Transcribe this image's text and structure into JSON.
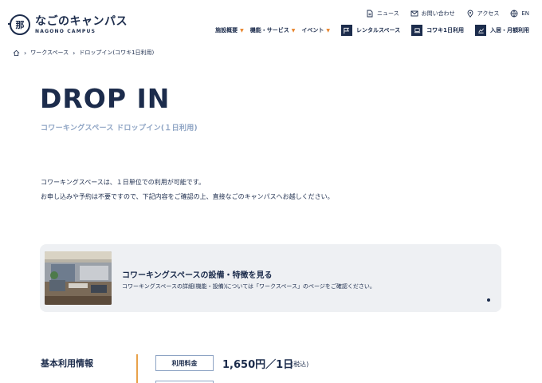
{
  "header": {
    "logo_ja": "なごのキャンパス",
    "logo_en": "NAGONO CAMPUS",
    "logo_mark": "那",
    "utility": [
      {
        "label": "ニュース",
        "icon": "document-icon"
      },
      {
        "label": "お問い合わせ",
        "icon": "mail-icon"
      },
      {
        "label": "アクセス",
        "icon": "location-pin-icon"
      },
      {
        "label": "EN",
        "icon": "globe-icon"
      }
    ],
    "nav": [
      {
        "label": "施設概要"
      },
      {
        "label": "機能・サービス"
      },
      {
        "label": "イベント"
      }
    ],
    "nav_boxes": [
      {
        "label": "レンタルスペース",
        "icon": "flag-icon"
      },
      {
        "label": "コワキ1日利用",
        "icon": "laptop-icon"
      },
      {
        "label": "入居・月額利用",
        "icon": "chart-up-icon"
      }
    ]
  },
  "breadcrumb": {
    "items": [
      "ワークスペース",
      "ドロップイン(コワキ1日利用)"
    ]
  },
  "page": {
    "title": "DROP IN",
    "subtitle": "コワーキングスペース ドロップイン(１日利用)",
    "body_line1": "コワーキングスペースは、１日単位での利用が可能です。",
    "body_line2": "お申し込みや予約は不要ですので、下記内容をご確認の上、直接なごのキャンパスへお越しください。"
  },
  "card": {
    "title": "コワーキングスペースの設備・特徴を見る",
    "desc": "コワーキングスペースの詳細(機能・設備)については「ワークスペース」のページをご確認ください。"
  },
  "info": {
    "heading": "基本利用情報",
    "label": "利用料金",
    "price": "1,650円／1日",
    "tax": "(税込)"
  },
  "colors": {
    "navy": "#1c2c4c",
    "accent_orange": "#e8832a",
    "muted_blue": "#8ea4c4",
    "card_bg": "#eef0f3"
  }
}
